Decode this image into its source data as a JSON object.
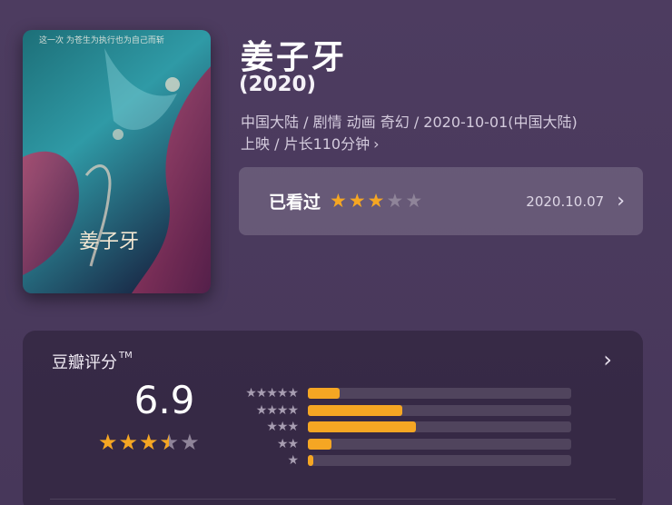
{
  "movie": {
    "title": "姜子牙",
    "year": "(2020)",
    "meta_line1": "中国大陆 / 剧情 动画 奇幻 / 2020-10-01(中国大陆)",
    "meta_line2": "上映 / 片长110分钟",
    "poster_tagline": "这一次 为苍生为执行也为自己而斩"
  },
  "watched": {
    "label": "已看过",
    "user_rating": 3,
    "max_rating": 5,
    "date": "2020.10.07"
  },
  "rating": {
    "title": "豆瓣评分",
    "trademark": "TM",
    "score": "6.9",
    "avg_stars": 3.5,
    "distribution": [
      {
        "stars": 5,
        "label": "★★★★★",
        "fraction": 0.12
      },
      {
        "stars": 4,
        "label": "★★★★",
        "fraction": 0.36
      },
      {
        "stars": 3,
        "label": "★★★",
        "fraction": 0.41
      },
      {
        "stars": 2,
        "label": "★★",
        "fraction": 0.09
      },
      {
        "stars": 1,
        "label": "★",
        "fraction": 0.02
      }
    ]
  },
  "colors": {
    "accent": "#f5a623",
    "background": "#4a3a5c"
  },
  "icons": {
    "chevron": "chevron-right-icon",
    "star": "star-icon"
  }
}
